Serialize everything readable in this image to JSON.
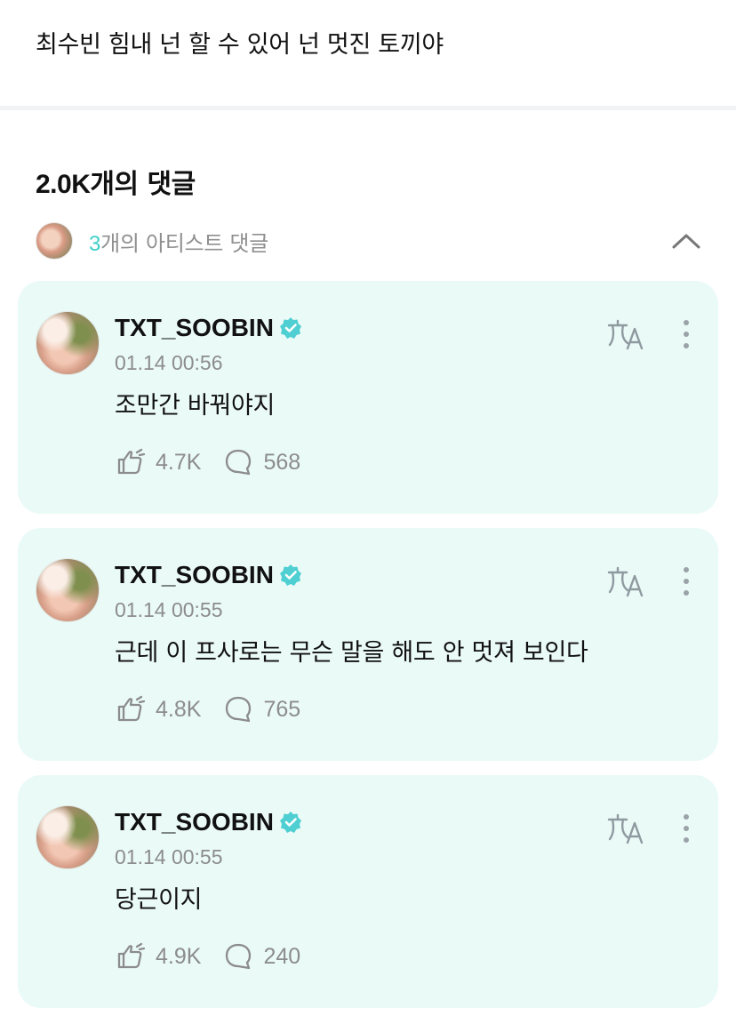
{
  "post": {
    "text": "최수빈 힘내 넌 할 수 있어 넌 멋진 토끼야"
  },
  "comments_header": {
    "count": "2.0K",
    "suffix": "개의 댓글"
  },
  "artist_comments": {
    "count": "3",
    "label": "개의 아티스트 댓글"
  },
  "colors": {
    "accent": "#3fcfc9",
    "card_bg": "#eafaf7",
    "muted": "#8c8c8c"
  },
  "cards": [
    {
      "username": "TXT_SOOBIN",
      "timestamp": "01.14 00:56",
      "comment": "조만간 바꿔야지",
      "likes": "4.7K",
      "replies": "568"
    },
    {
      "username": "TXT_SOOBIN",
      "timestamp": "01.14 00:55",
      "comment": "근데 이 프사로는 무슨 말을 해도 안 멋져 보인다",
      "likes": "4.8K",
      "replies": "765"
    },
    {
      "username": "TXT_SOOBIN",
      "timestamp": "01.14 00:55",
      "comment": "당근이지",
      "likes": "4.9K",
      "replies": "240"
    }
  ],
  "icons": {
    "verified": "verified-badge-icon",
    "translate": "translate-icon",
    "more": "more-vertical-icon",
    "like": "like-icon",
    "reply": "comment-bubble-icon",
    "collapse": "chevron-up-icon"
  }
}
